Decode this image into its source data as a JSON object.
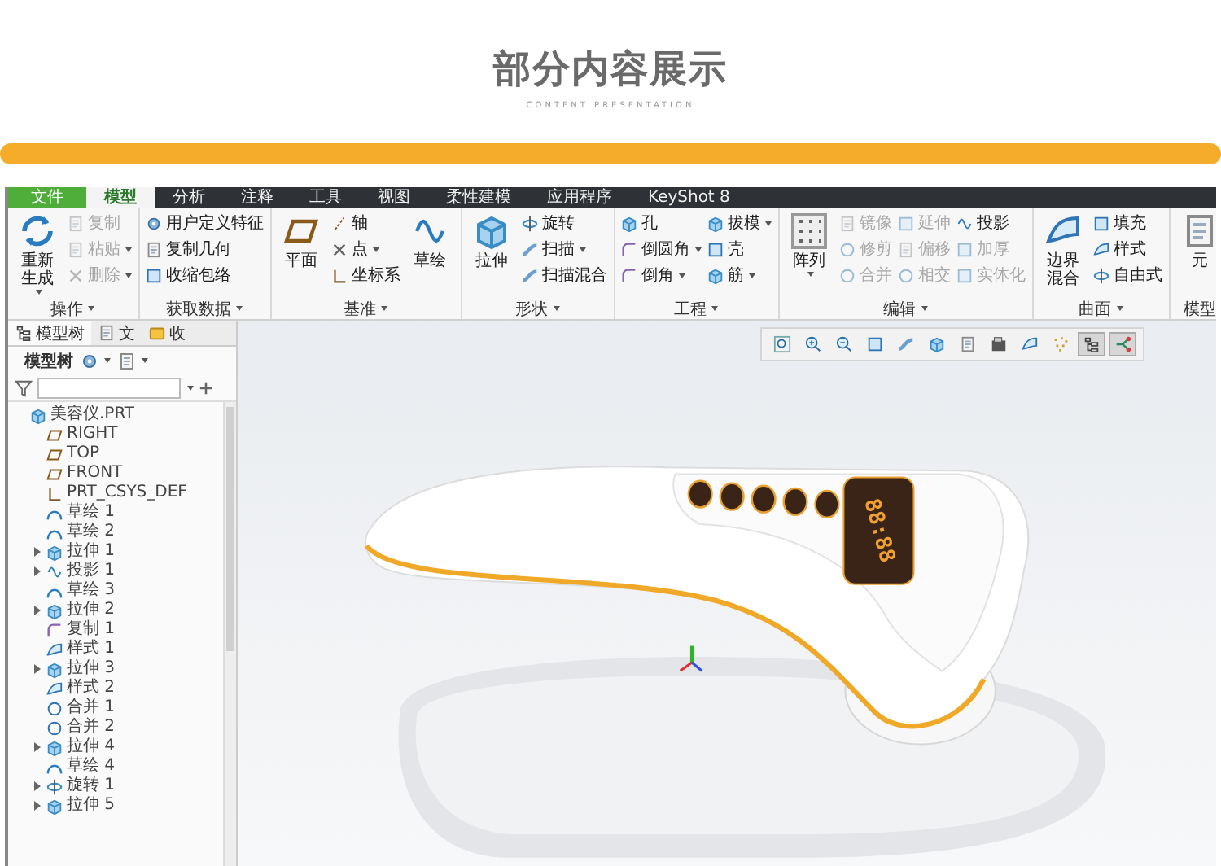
{
  "heading": {
    "title": "部分内容展示",
    "subtitle": "CONTENT PRESENTATION"
  },
  "app": {
    "tabs": [
      {
        "label": "文件",
        "kind": "file",
        "selected": false
      },
      {
        "label": "模型",
        "kind": "tab",
        "selected": true
      },
      {
        "label": "分析",
        "kind": "tab",
        "selected": false
      },
      {
        "label": "注释",
        "kind": "tab",
        "selected": false
      },
      {
        "label": "工具",
        "kind": "tab",
        "selected": false
      },
      {
        "label": "视图",
        "kind": "tab",
        "selected": false
      },
      {
        "label": "柔性建模",
        "kind": "tab",
        "selected": false
      },
      {
        "label": "应用程序",
        "kind": "tab",
        "selected": false
      },
      {
        "label": "KeyShot 8",
        "kind": "tab",
        "selected": false
      }
    ],
    "ribbon": [
      {
        "label": "操作",
        "dropdown": true,
        "items": [
          {
            "kind": "large",
            "label": "重新生成",
            "dropdown": true,
            "disabled": false
          },
          {
            "kind": "stack",
            "buttons": [
              {
                "label": "复制",
                "dropdown": false,
                "disabled": true
              },
              {
                "label": "粘贴",
                "dropdown": true,
                "disabled": true
              },
              {
                "label": "删除",
                "dropdown": true,
                "disabled": true
              }
            ]
          }
        ]
      },
      {
        "label": "获取数据",
        "dropdown": true,
        "items": [
          {
            "kind": "stack",
            "buttons": [
              {
                "label": "用户定义特征",
                "dropdown": false,
                "disabled": false
              },
              {
                "label": "复制几何",
                "dropdown": false,
                "disabled": false
              },
              {
                "label": "收缩包络",
                "dropdown": false,
                "disabled": false
              }
            ]
          }
        ]
      },
      {
        "label": "基准",
        "dropdown": true,
        "items": [
          {
            "kind": "large",
            "label": "平面",
            "dropdown": false,
            "disabled": false
          },
          {
            "kind": "stack",
            "buttons": [
              {
                "label": "轴",
                "dropdown": false,
                "disabled": false
              },
              {
                "label": "点",
                "dropdown": true,
                "disabled": false
              },
              {
                "label": "坐标系",
                "dropdown": false,
                "disabled": false
              }
            ]
          },
          {
            "kind": "large",
            "label": "草绘",
            "dropdown": false,
            "disabled": false
          }
        ]
      },
      {
        "label": "形状",
        "dropdown": true,
        "items": [
          {
            "kind": "large",
            "label": "拉伸",
            "dropdown": false,
            "disabled": false
          },
          {
            "kind": "stack",
            "buttons": [
              {
                "label": "旋转",
                "dropdown": false,
                "disabled": false
              },
              {
                "label": "扫描",
                "dropdown": true,
                "disabled": false
              },
              {
                "label": "扫描混合",
                "dropdown": false,
                "disabled": false
              }
            ]
          }
        ]
      },
      {
        "label": "工程",
        "dropdown": true,
        "items": [
          {
            "kind": "stack",
            "buttons": [
              {
                "label": "孔",
                "dropdown": false,
                "disabled": false
              },
              {
                "label": "倒圆角",
                "dropdown": true,
                "disabled": false
              },
              {
                "label": "倒角",
                "dropdown": true,
                "disabled": false
              }
            ]
          },
          {
            "kind": "stack",
            "buttons": [
              {
                "label": "拔模",
                "dropdown": true,
                "disabled": false
              },
              {
                "label": "壳",
                "dropdown": false,
                "disabled": false
              },
              {
                "label": "筋",
                "dropdown": true,
                "disabled": false
              }
            ]
          }
        ]
      },
      {
        "label": "编辑",
        "dropdown": true,
        "items": [
          {
            "kind": "large",
            "label": "阵列",
            "dropdown": true,
            "disabled": false
          },
          {
            "kind": "stack",
            "buttons": [
              {
                "label": "镜像",
                "dropdown": false,
                "disabled": true
              },
              {
                "label": "修剪",
                "dropdown": false,
                "disabled": true
              },
              {
                "label": "合并",
                "dropdown": false,
                "disabled": true
              }
            ]
          },
          {
            "kind": "stack",
            "buttons": [
              {
                "label": "延伸",
                "dropdown": false,
                "disabled": true
              },
              {
                "label": "偏移",
                "dropdown": false,
                "disabled": true
              },
              {
                "label": "相交",
                "dropdown": false,
                "disabled": true
              }
            ]
          },
          {
            "kind": "stack",
            "buttons": [
              {
                "label": "投影",
                "dropdown": false,
                "disabled": false
              },
              {
                "label": "加厚",
                "dropdown": false,
                "disabled": true
              },
              {
                "label": "实体化",
                "dropdown": false,
                "disabled": true
              }
            ]
          }
        ]
      },
      {
        "label": "曲面",
        "dropdown": true,
        "items": [
          {
            "kind": "large",
            "label": "边界混合",
            "dropdown": false,
            "disabled": false
          },
          {
            "kind": "stack",
            "buttons": [
              {
                "label": "填充",
                "dropdown": false,
                "disabled": false
              },
              {
                "label": "样式",
                "dropdown": false,
                "disabled": false
              },
              {
                "label": "自由式",
                "dropdown": false,
                "disabled": false
              }
            ]
          }
        ]
      },
      {
        "label": "模型",
        "dropdown": false,
        "items": [
          {
            "kind": "large",
            "label": "元",
            "dropdown": false,
            "disabled": false
          }
        ]
      }
    ],
    "panel": {
      "tabs": [
        {
          "label": "模型树",
          "selected": true
        },
        {
          "label": "文",
          "selected": false
        },
        {
          "label": "收",
          "selected": false
        }
      ],
      "toolbar_label": "模型树",
      "tree": [
        {
          "label": "美容仪.PRT",
          "kind": "part",
          "children": [
            {
              "label": "RIGHT",
              "kind": "plane"
            },
            {
              "label": "TOP",
              "kind": "plane"
            },
            {
              "label": "FRONT",
              "kind": "plane"
            },
            {
              "label": "PRT_CSYS_DEF",
              "kind": "csys"
            },
            {
              "label": "草绘 1",
              "kind": "sketch"
            },
            {
              "label": "草绘 2",
              "kind": "sketch"
            },
            {
              "label": "拉伸 1",
              "kind": "extrude",
              "expanded": false
            },
            {
              "label": "投影 1",
              "kind": "projection",
              "expanded": false
            },
            {
              "label": "草绘 3",
              "kind": "sketch"
            },
            {
              "label": "拉伸 2",
              "kind": "extrude",
              "expanded": false
            },
            {
              "label": "复制 1",
              "kind": "copy"
            },
            {
              "label": "样式 1",
              "kind": "style"
            },
            {
              "label": "拉伸 3",
              "kind": "extrude",
              "expanded": false
            },
            {
              "label": "样式 2",
              "kind": "style"
            },
            {
              "label": "合并 1",
              "kind": "merge"
            },
            {
              "label": "合并 2",
              "kind": "merge"
            },
            {
              "label": "拉伸 4",
              "kind": "extrude",
              "expanded": false
            },
            {
              "label": "草绘 4",
              "kind": "sketch"
            },
            {
              "label": "旋转 1",
              "kind": "revolve",
              "expanded": false
            },
            {
              "label": "拉伸 5",
              "kind": "extrude",
              "expanded": false
            }
          ]
        }
      ]
    },
    "view_tools": [
      {
        "selected": false
      },
      {
        "selected": false
      },
      {
        "selected": false
      },
      {
        "selected": false
      },
      {
        "selected": false
      },
      {
        "selected": false
      },
      {
        "selected": false
      },
      {
        "selected": false
      },
      {
        "selected": false
      },
      {
        "selected": false
      },
      {
        "selected": true
      },
      {
        "selected": true
      }
    ],
    "model": {
      "display_text": "88:88"
    }
  }
}
